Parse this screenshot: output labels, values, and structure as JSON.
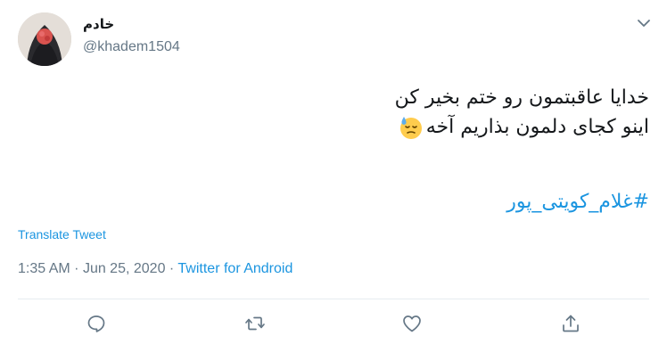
{
  "user": {
    "display_name": "خادم",
    "handle": "@khadem1504"
  },
  "tweet": {
    "line1": "خدایا عاقبتمون رو ختم بخیر کن",
    "line2": "اینو کجای دلمون بذاریم آخه",
    "emoji": "downcast-face-with-sweat",
    "hashtag": "#غلام_کویتی_پور"
  },
  "translate_label": "Translate Tweet",
  "meta": {
    "time": "1:35 AM",
    "separator": "·",
    "date": "Jun 25, 2020",
    "source": "Twitter for Android"
  },
  "actions": {
    "reply": "reply-icon",
    "retweet": "retweet-icon",
    "like": "like-icon",
    "share": "share-icon"
  },
  "colors": {
    "link": "#1b95e0",
    "muted": "#657786",
    "text": "#14171a",
    "divider": "#e6ecf0"
  }
}
